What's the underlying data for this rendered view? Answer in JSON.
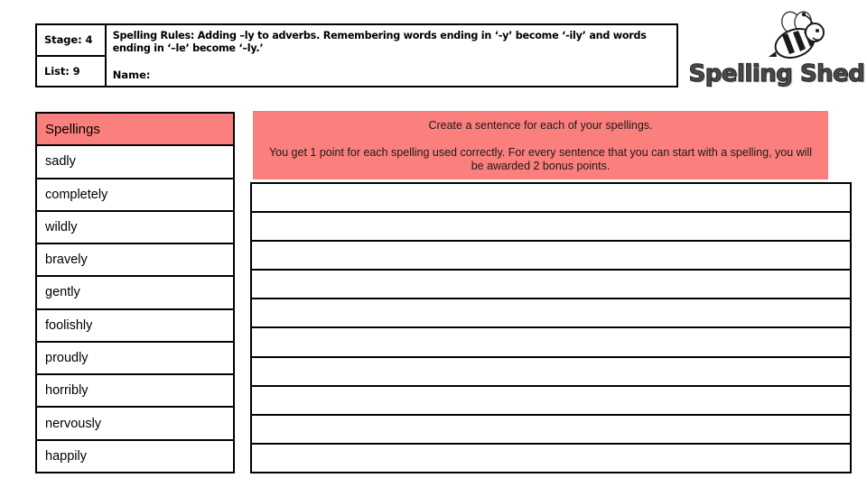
{
  "header": {
    "stage_label": "Stage: 4",
    "list_label": "List: 9",
    "rules_text": "Spelling Rules: Adding –ly to adverbs. Remembering words ending in ‘-y’ become ‘-ily’ and words ending in ‘–le’ become ‘–ly.’",
    "name_label": "Name:"
  },
  "logo": {
    "wordmark": "Spelling Shed",
    "bee_icon": "bee-icon"
  },
  "spellings": {
    "header": "Spellings",
    "words": [
      "sadly",
      "completely",
      "wildly",
      "bravely",
      "gently",
      "foolishly",
      "proudly",
      "horribly",
      "nervously",
      "happily"
    ]
  },
  "instructions": {
    "line1": "Create a sentence for each of your spellings.",
    "line2": "You get 1 point for each spelling used correctly.  For every sentence that you can start with a spelling, you will be awarded 2 bonus points."
  },
  "writing_area": {
    "row_count": 10,
    "rows": [
      "",
      "",
      "",
      "",
      "",
      "",
      "",
      "",
      "",
      ""
    ]
  },
  "colors": {
    "accent_salmon": "#fb7f7c",
    "border": "#000000",
    "page_background": "#ffffff"
  }
}
